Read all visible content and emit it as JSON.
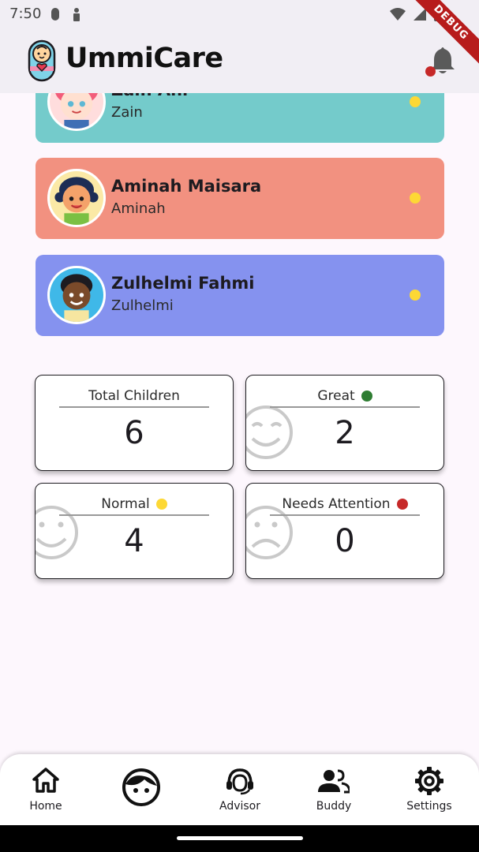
{
  "status_bar": {
    "time": "7:50",
    "debug_label": "DEBUG"
  },
  "app": {
    "title": "UmmiCare"
  },
  "children": [
    {
      "name": "Zain Ani",
      "nickname": "Zain",
      "card_color": "#74cbcb",
      "status_color": "#fdd835"
    },
    {
      "name": "Aminah Maisara",
      "nickname": "Aminah",
      "card_color": "#f29180",
      "status_color": "#fdd835"
    },
    {
      "name": "Zulhelmi Fahmi",
      "nickname": "Zulhelmi",
      "card_color": "#8592ef",
      "status_color": "#fdd835"
    }
  ],
  "stats": {
    "total": {
      "label": "Total Children",
      "value": "6"
    },
    "great": {
      "label": "Great",
      "value": "2",
      "dot_color": "#2e7d32"
    },
    "normal": {
      "label": "Normal",
      "value": "4",
      "dot_color": "#fdd835"
    },
    "attention": {
      "label": "Needs Attention",
      "value": "0",
      "dot_color": "#c62828"
    }
  },
  "nav": {
    "home": "Home",
    "advisor": "Advisor",
    "buddy": "Buddy",
    "settings": "Settings"
  }
}
